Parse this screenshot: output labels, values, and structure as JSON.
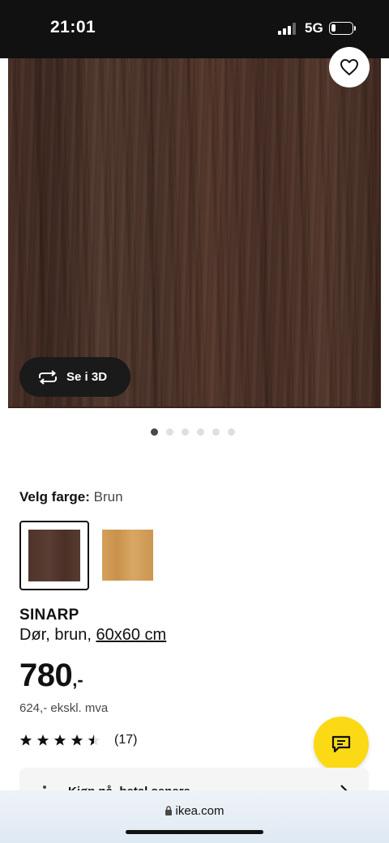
{
  "status_bar": {
    "time": "21:01",
    "network": "5G"
  },
  "gallery": {
    "view_3d_label": "Se i 3D",
    "image_count": 6,
    "active_index": 0
  },
  "color_picker": {
    "prefix": "Velg farge:",
    "selected": "Brun",
    "swatches": [
      {
        "name": "brun",
        "color": "#533a2f"
      },
      {
        "name": "eik",
        "color": "#d19c57"
      }
    ]
  },
  "product": {
    "name": "SINARP",
    "description": "Dør, brun, ",
    "size": "60x60 cm",
    "price_main": "780",
    "price_suffix": ",-",
    "price_excl_vat": "624,- ekskl. mva",
    "rating": 4.5,
    "review_count": "(17)"
  },
  "card": {
    "label": "Kjøp nå, betal senere"
  },
  "browser": {
    "url": "ikea.com"
  },
  "colors": {
    "accent": "#fbd914",
    "dark": "#111111",
    "muted": "#484848"
  }
}
